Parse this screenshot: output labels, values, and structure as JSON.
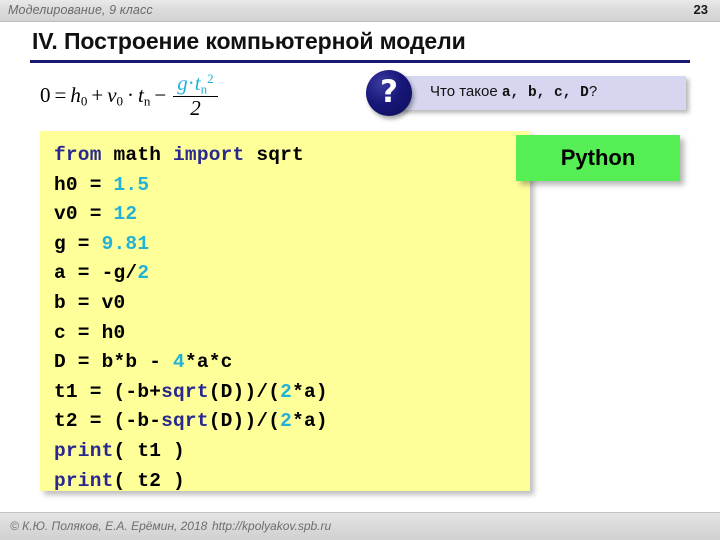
{
  "header": {
    "course_title": "Моделирование, 9 класс",
    "page_number": "23"
  },
  "slide": {
    "title": "IV. Построение компьютерной модели",
    "rule_color": "#191970"
  },
  "formula": {
    "text": "0 = h0 + v0 · tn − (g · tn²) / 2",
    "lhs": "0",
    "equals": "=",
    "term1_base": "h",
    "term1_sub": "0",
    "plus": "+",
    "term2_base": "v",
    "term2_sub": "0",
    "dot": "·",
    "term3_base": "t",
    "term3_sub": "n",
    "minus": "−",
    "numer_g": "g",
    "numer_dot": "·",
    "numer_t": "t",
    "numer_sub": "n",
    "numer_sup": "2",
    "denom": "2"
  },
  "callout": {
    "icon": "question-mark",
    "icon_glyph": "?",
    "text_before": "Что такое ",
    "vars": "a, b, c, D",
    "text_after": "?",
    "background_color": "#d6d6f0",
    "badge_color": "#17177a"
  },
  "python_badge": {
    "label": "Python",
    "background_color": "#55ee55"
  },
  "code": {
    "background_color": "#ffff99",
    "keyword_color": "#282890",
    "number_color": "#22b2d8",
    "lines": [
      [
        {
          "t": "from",
          "c": "kw"
        },
        {
          "t": " math ",
          "c": ""
        },
        {
          "t": "import",
          "c": "kw"
        },
        {
          "t": " sqrt",
          "c": ""
        }
      ],
      [
        {
          "t": "h0 = ",
          "c": ""
        },
        {
          "t": "1.5",
          "c": "num"
        }
      ],
      [
        {
          "t": "v0 = ",
          "c": ""
        },
        {
          "t": "12",
          "c": "num"
        }
      ],
      [
        {
          "t": "g = ",
          "c": ""
        },
        {
          "t": "9.81",
          "c": "num"
        }
      ],
      [
        {
          "t": "a = -g/",
          "c": ""
        },
        {
          "t": "2",
          "c": "num"
        }
      ],
      [
        {
          "t": "b = v0",
          "c": ""
        }
      ],
      [
        {
          "t": "c = h0",
          "c": ""
        }
      ],
      [
        {
          "t": "D = b*b - ",
          "c": ""
        },
        {
          "t": "4",
          "c": "num"
        },
        {
          "t": "*a*c",
          "c": ""
        }
      ],
      [
        {
          "t": "t1 = (-b+",
          "c": ""
        },
        {
          "t": "sqrt",
          "c": "fn"
        },
        {
          "t": "(D))/(",
          "c": ""
        },
        {
          "t": "2",
          "c": "num"
        },
        {
          "t": "*a)",
          "c": ""
        }
      ],
      [
        {
          "t": "t2 = (-b-",
          "c": ""
        },
        {
          "t": "sqrt",
          "c": "fn"
        },
        {
          "t": "(D))/(",
          "c": ""
        },
        {
          "t": "2",
          "c": "num"
        },
        {
          "t": "*a)",
          "c": ""
        }
      ],
      [
        {
          "t": "print",
          "c": "fn"
        },
        {
          "t": "( t1 )",
          "c": ""
        }
      ],
      [
        {
          "t": "print",
          "c": "fn"
        },
        {
          "t": "( t2 )",
          "c": ""
        }
      ]
    ]
  },
  "footer": {
    "copyright": "© К.Ю. Поляков, Е.А. Ерёмин, 2018",
    "url": "http://kpolyakov.spb.ru"
  }
}
